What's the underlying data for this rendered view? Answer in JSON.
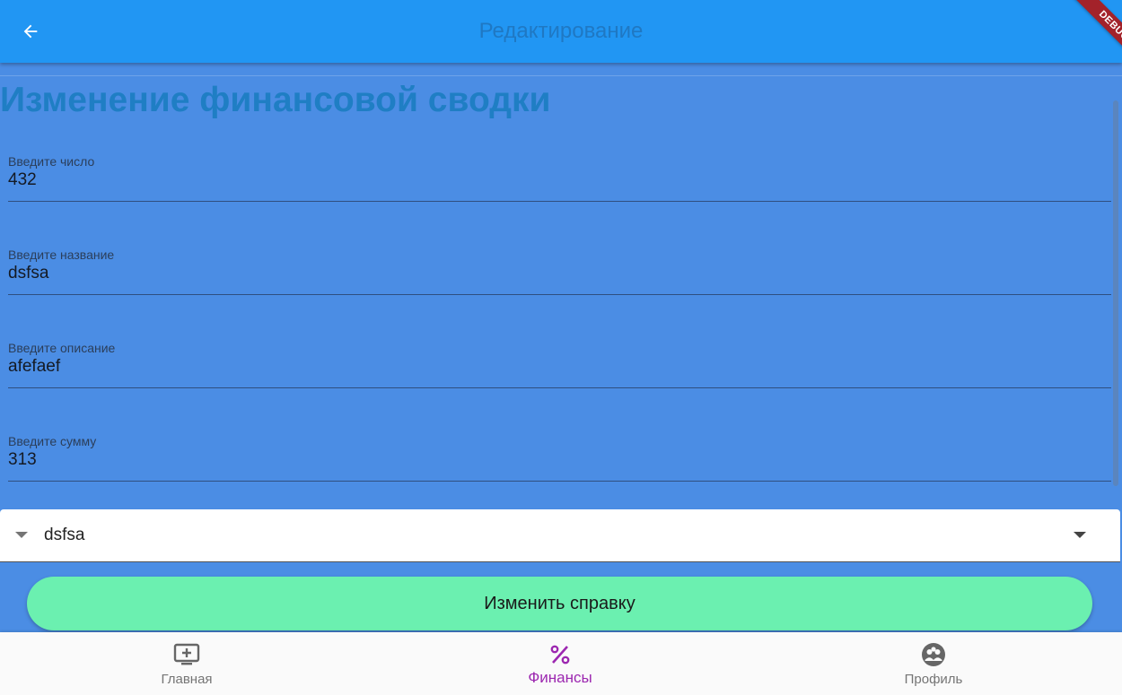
{
  "appbar": {
    "title": "Редактирование",
    "back_icon": "arrow-back-icon",
    "debug_label": "DEBUG"
  },
  "form": {
    "heading": "Изменение финансовой сводки",
    "fields": [
      {
        "label": "Введите число",
        "value": "432"
      },
      {
        "label": "Введите название",
        "value": "dsfsa"
      },
      {
        "label": "Введите описание",
        "value": "afefaef"
      },
      {
        "label": "Введите сумму",
        "value": "313"
      }
    ],
    "dropdown": {
      "value": "dsfsa",
      "icon": "arrow-drop-down-icon"
    },
    "submit_label": "Изменить справку"
  },
  "bottom_nav": {
    "items": [
      {
        "label": "Главная",
        "icon": "add-to-queue-icon",
        "active": false
      },
      {
        "label": "Финансы",
        "icon": "percent-icon",
        "active": true
      },
      {
        "label": "Профиль",
        "icon": "group-icon",
        "active": false
      }
    ]
  },
  "colors": {
    "appbar": "#2196f3",
    "content_bg": "#4b8de4",
    "heading": "#1f7ec4",
    "button": "#6bf0b0",
    "nav_active": "#9c27b0",
    "debug_ribbon": "#a3222a"
  }
}
